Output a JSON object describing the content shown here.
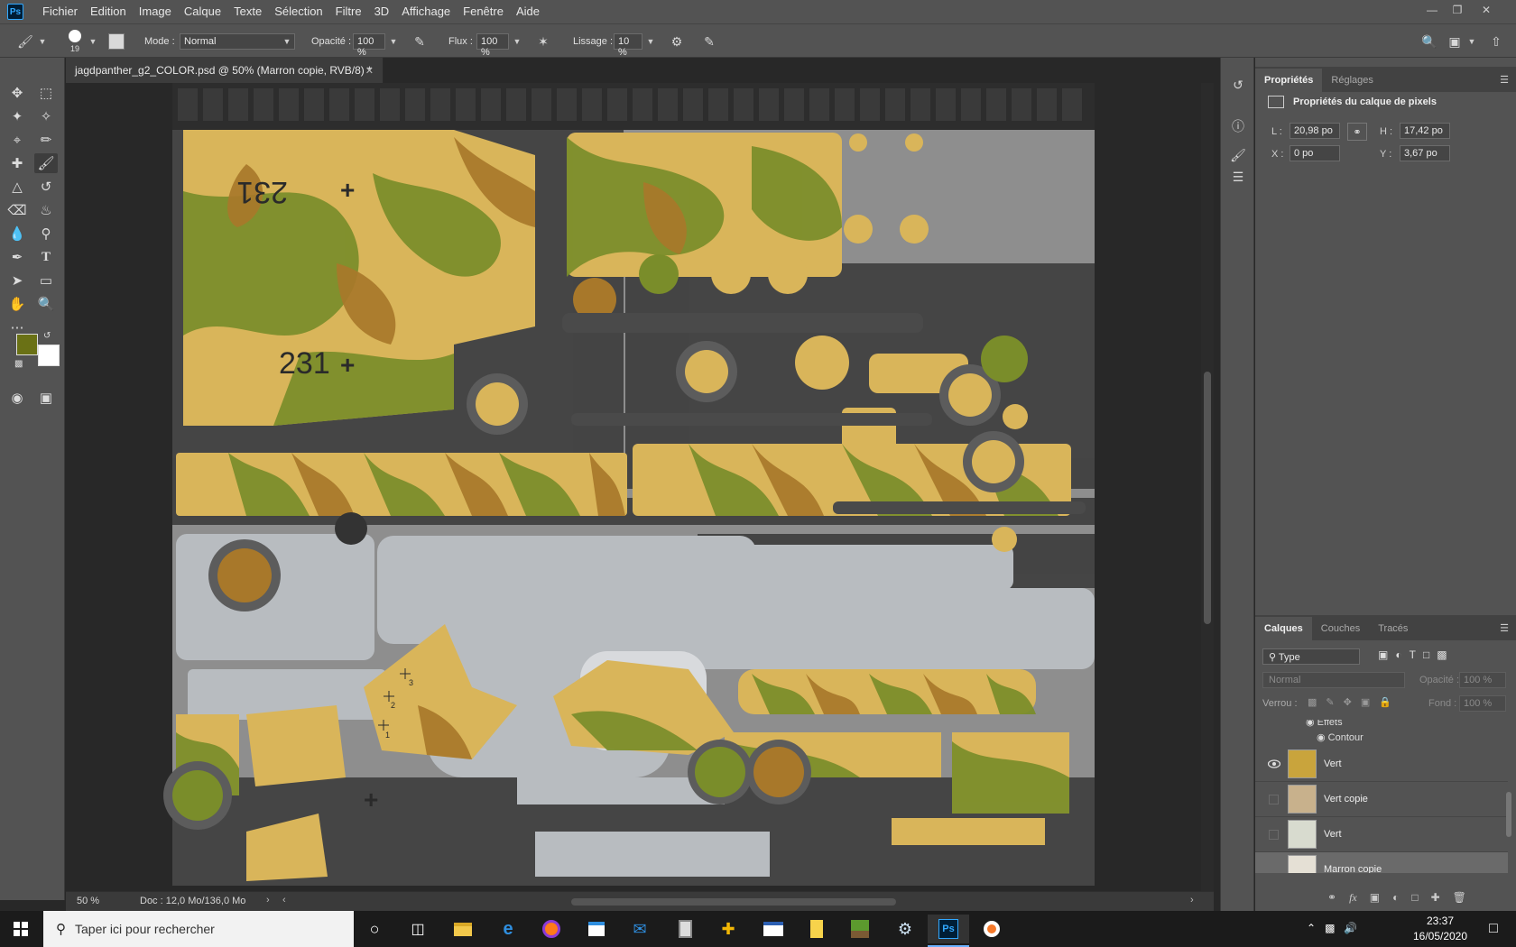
{
  "app": {
    "logo": "Ps"
  },
  "menu": [
    "Fichier",
    "Edition",
    "Image",
    "Calque",
    "Texte",
    "Sélection",
    "Filtre",
    "3D",
    "Affichage",
    "Fenêtre",
    "Aide"
  ],
  "options": {
    "brush_size": "19",
    "mode_label": "Mode :",
    "mode_value": "Normal",
    "opacity_label": "Opacité :",
    "opacity_value": "100 %",
    "flow_label": "Flux :",
    "flow_value": "100 %",
    "smoothing_label": "Lissage :",
    "smoothing_value": "10 %"
  },
  "colors": {
    "foreground": "#6a7115",
    "background": "#ffffff",
    "accent": "#31a8ff"
  },
  "document": {
    "tab_title": "jagdpanther_g2_COLOR.psd @ 50% (Marron copie, RVB/8) *",
    "canvas_text": [
      "231",
      "231",
      "2",
      "3",
      "1"
    ]
  },
  "status": {
    "zoom": "50 %",
    "doc_info": "Doc : 12,0 Mo/136,0 Mo"
  },
  "properties": {
    "tabs": [
      "Propriétés",
      "Réglages"
    ],
    "title": "Propriétés du calque de pixels",
    "w_label": "L :",
    "w_value": "20,98 po",
    "h_label": "H :",
    "h_value": "17,42 po",
    "x_label": "X :",
    "x_value": "0 po",
    "y_label": "Y :",
    "y_value": "3,67 po"
  },
  "layers_panel": {
    "tabs": [
      "Calques",
      "Couches",
      "Tracés"
    ],
    "filter_value": "Type",
    "blend_value": "Normal",
    "opacity_label": "Opacité :",
    "opacity_value": "100 %",
    "lock_label": "Verrou :",
    "fill_label": "Fond :",
    "fill_value": "100 %",
    "effects_label": "Effets",
    "contour_label": "Contour",
    "layers": [
      {
        "name": "Vert",
        "visible": true,
        "selected": false
      },
      {
        "name": "Vert copie",
        "visible": false,
        "selected": false
      },
      {
        "name": "Vert",
        "visible": false,
        "selected": false
      },
      {
        "name": "Marron copie",
        "visible": false,
        "selected": true
      }
    ]
  },
  "taskbar": {
    "search_placeholder": "Taper ici pour rechercher",
    "time": "23:37",
    "date": "16/05/2020",
    "apps": [
      "task-view",
      "file-explorer",
      "edge",
      "firefox",
      "store",
      "mail",
      "calculator",
      "app-yellow",
      "window-app",
      "notes",
      "minecraft",
      "steam",
      "photoshop",
      "blender"
    ]
  }
}
